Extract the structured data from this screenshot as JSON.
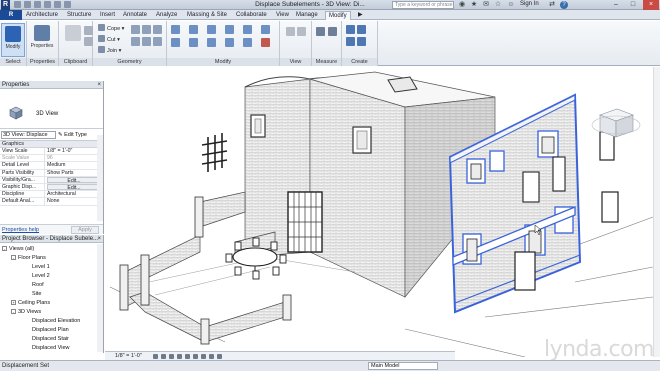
{
  "titlebar": {
    "window_title": "Displace Subelements - 3D View: Di...",
    "search_placeholder": "Type a keyword or phrase",
    "sign_in": "Sign In"
  },
  "ribbon_tabs": [
    "Architecture",
    "Structure",
    "Insert",
    "Annotate",
    "Analyze",
    "Massing & Site",
    "Collaborate",
    "View",
    "Manage",
    "Modify"
  ],
  "active_tab": "Modify",
  "ribbon": {
    "modify_label": "Modify",
    "properties_label": "Properties",
    "cope_label": "Cope",
    "cut_label": "Cut",
    "join_label": "Join",
    "panels": [
      "Select",
      "Properties",
      "Clipboard",
      "Geometry",
      "Modify",
      "View",
      "Measure",
      "Create"
    ]
  },
  "properties": {
    "title": "Properties",
    "type_name": "3D View",
    "instance_selector": "3D View: Displace",
    "edit_type": "Edit Type",
    "group_graphics": "Graphics",
    "rows": [
      {
        "k": "View Scale",
        "v": "1/8\" = 1'-0\""
      },
      {
        "k": "Scale Value",
        "v": "96"
      },
      {
        "k": "Detail Level",
        "v": "Medium"
      },
      {
        "k": "Parts Visibility",
        "v": "Show Parts"
      },
      {
        "k": "Visibility/Gra...",
        "v": "Edit..."
      },
      {
        "k": "Graphic Disp...",
        "v": "Edit..."
      },
      {
        "k": "Discipline",
        "v": "Architectural"
      },
      {
        "k": "Default Anal...",
        "v": "None"
      }
    ],
    "help_link": "Properties help",
    "apply": "Apply"
  },
  "browser": {
    "title": "Project Browser - Displace Subele...",
    "items": [
      {
        "label": "Views (all)",
        "toggle": "-"
      },
      {
        "label": "Floor Plans",
        "toggle": "-"
      },
      {
        "label": "Level 1",
        "toggle": ""
      },
      {
        "label": "Level 2",
        "toggle": ""
      },
      {
        "label": "Roof",
        "toggle": ""
      },
      {
        "label": "Site",
        "toggle": ""
      },
      {
        "label": "Ceiling Plans",
        "toggle": "+"
      },
      {
        "label": "3D Views",
        "toggle": "-"
      },
      {
        "label": "Displaced Elevation",
        "toggle": ""
      },
      {
        "label": "Displaced Plan",
        "toggle": ""
      },
      {
        "label": "Displaced Stair",
        "toggle": ""
      },
      {
        "label": "Displaced View",
        "toggle": ""
      }
    ]
  },
  "viewbar": {
    "scale": "1/8\" = 1'-0\""
  },
  "status": {
    "text": "Displacement Set",
    "model": "Main Model",
    "watermark": "lynda.com"
  },
  "colors": {
    "selection_blue": "#3a63d9",
    "brand_blue": "#1b4b96"
  }
}
